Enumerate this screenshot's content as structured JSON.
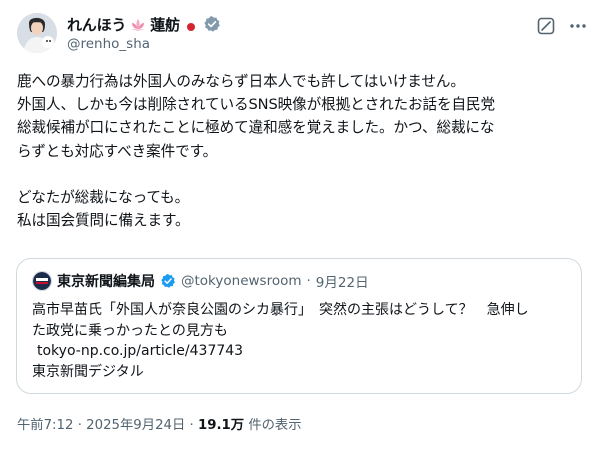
{
  "author": {
    "display_name": "れんほう",
    "display_name_suffix": "蓮舫",
    "handle": "@renho_sha",
    "verified_color": "#829aab"
  },
  "body": {
    "lines": [
      "鹿への暴力行為は外国人のみならず日本人でも許してはいけません。",
      "外国人、しかも今は削除されているSNS映像が根拠とされたお話を自民党",
      "総裁候補が口にされたことに極めて違和感を覚えました。かつ、総裁にな",
      "らずとも対応すべき案件です。",
      "",
      "どなたが総裁になっても。",
      "私は国会質問に備えます。"
    ]
  },
  "quote": {
    "account_name": "東京新聞編集局",
    "handle": "@tokyonewsroom",
    "separator": "·",
    "date": "9月22日",
    "verified_color": "#1d9bf0",
    "lines": [
      "高市早苗氏「外国人が奈良公園のシカ暴行」　突然の主張はどうして？　急伸し",
      "た政党に乗っかったとの見方も"
    ],
    "link": "tokyo-np.co.jp/article/437743",
    "source": "東京新聞デジタル"
  },
  "footer": {
    "time": "午前7:12",
    "sep1": "·",
    "date": "2025年9月24日",
    "sep2": "·",
    "views": "19.1万",
    "views_label": "件の表示"
  },
  "icons": {
    "more": "more-icon",
    "grok": "grok-icon",
    "verified": "verified-badge-icon",
    "lotus": "lotus-icon",
    "flag": "japan-flag-icon"
  }
}
